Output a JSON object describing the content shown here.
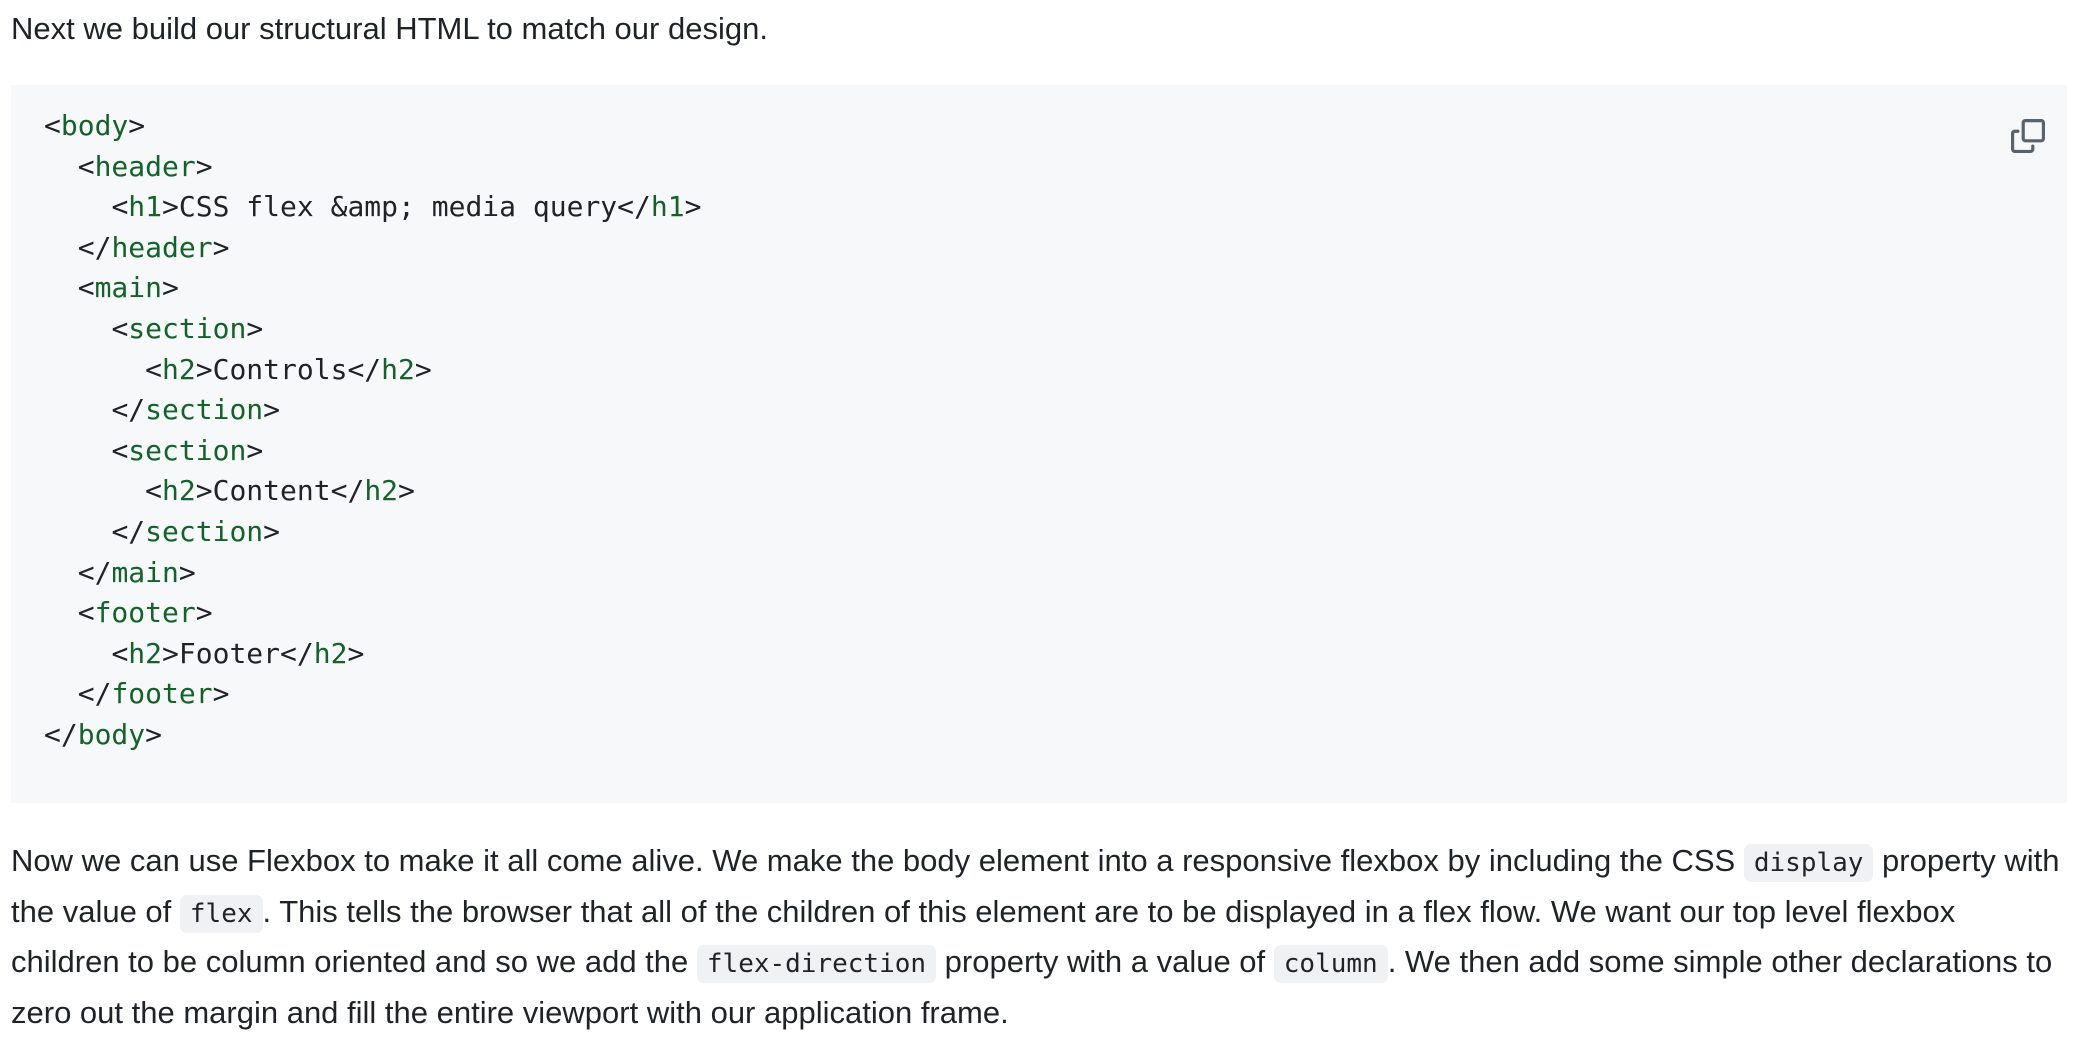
{
  "intro_text": "Next we build our structural HTML to match our design.",
  "code": {
    "lines": [
      {
        "indent": "",
        "pre": "<",
        "tag": "body",
        "mid": ">",
        "tag2": "",
        "post": ""
      },
      {
        "indent": "  ",
        "pre": "<",
        "tag": "header",
        "mid": ">",
        "tag2": "",
        "post": ""
      },
      {
        "indent": "    ",
        "pre": "<",
        "tag": "h1",
        "mid": ">CSS flex &amp; media query</",
        "tag2": "h1",
        "post": ">"
      },
      {
        "indent": "  ",
        "pre": "</",
        "tag": "header",
        "mid": ">",
        "tag2": "",
        "post": ""
      },
      {
        "indent": "  ",
        "pre": "<",
        "tag": "main",
        "mid": ">",
        "tag2": "",
        "post": ""
      },
      {
        "indent": "    ",
        "pre": "<",
        "tag": "section",
        "mid": ">",
        "tag2": "",
        "post": ""
      },
      {
        "indent": "      ",
        "pre": "<",
        "tag": "h2",
        "mid": ">Controls</",
        "tag2": "h2",
        "post": ">"
      },
      {
        "indent": "    ",
        "pre": "</",
        "tag": "section",
        "mid": ">",
        "tag2": "",
        "post": ""
      },
      {
        "indent": "    ",
        "pre": "<",
        "tag": "section",
        "mid": ">",
        "tag2": "",
        "post": ""
      },
      {
        "indent": "      ",
        "pre": "<",
        "tag": "h2",
        "mid": ">Content</",
        "tag2": "h2",
        "post": ">"
      },
      {
        "indent": "    ",
        "pre": "</",
        "tag": "section",
        "mid": ">",
        "tag2": "",
        "post": ""
      },
      {
        "indent": "  ",
        "pre": "</",
        "tag": "main",
        "mid": ">",
        "tag2": "",
        "post": ""
      },
      {
        "indent": "  ",
        "pre": "<",
        "tag": "footer",
        "mid": ">",
        "tag2": "",
        "post": ""
      },
      {
        "indent": "    ",
        "pre": "<",
        "tag": "h2",
        "mid": ">Footer</",
        "tag2": "h2",
        "post": ">"
      },
      {
        "indent": "  ",
        "pre": "</",
        "tag": "footer",
        "mid": ">",
        "tag2": "",
        "post": ""
      },
      {
        "indent": "",
        "pre": "</",
        "tag": "body",
        "mid": ">",
        "tag2": "",
        "post": ""
      }
    ],
    "copy_icon": "copy-icon"
  },
  "paragraph": {
    "t1": "Now we can use Flexbox to make it all come alive. We make the body element into a responsive flexbox by including the CSS ",
    "c1": "display",
    "t2": " property with the value of ",
    "c2": "flex",
    "t3": ". This tells the browser that all of the children of this element are to be displayed in a flex flow. We want our top level flexbox children to be column oriented and so we add the ",
    "c3": "flex-direction",
    "t4": " property with a value of ",
    "c4": "column",
    "t5": ". We then add some simple other declarations to zero out the margin and fill the entire viewport with our application frame."
  },
  "colors": {
    "code_bg": "#f6f8fa",
    "tag_color": "#116329",
    "text_color": "#1f2328",
    "inline_code_bg": "#eff1f3"
  }
}
